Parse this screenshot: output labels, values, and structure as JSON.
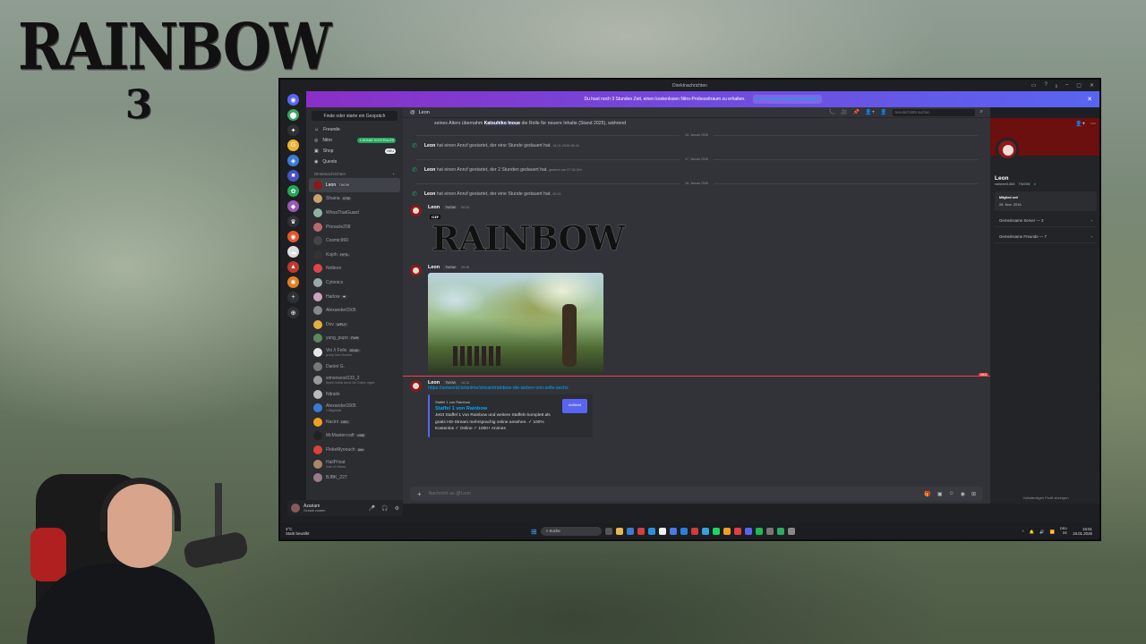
{
  "overlay": {
    "logo_text": "RAINBOW",
    "logo_number": "3"
  },
  "window": {
    "title": "Direktnachrichten",
    "controls": [
      "▭",
      "?",
      "⭳",
      "–",
      "▢",
      "✕"
    ]
  },
  "nitro_banner": {
    "text": "Du hast noch 3 Stunden Zeit, einen kostenlosen Nitro-Probezeitraum zu erhalten.",
    "link": "Hol dir dein kostenloses Nitro!",
    "close": "✕"
  },
  "rail": {
    "servers": [
      {
        "color": "#5865f2",
        "glyph": "◉"
      },
      {
        "color": "#3ba55c",
        "glyph": "⬤"
      },
      {
        "color": "#2f3136",
        "glyph": "✦"
      },
      {
        "color": "#f0b232",
        "glyph": "G"
      },
      {
        "color": "#3a7bd5",
        "glyph": "◈"
      },
      {
        "color": "#4752c4",
        "glyph": "■"
      },
      {
        "color": "#23a55a",
        "glyph": "✿"
      },
      {
        "color": "#9b59b6",
        "glyph": "◆"
      },
      {
        "color": "#2f3136",
        "glyph": "♛"
      },
      {
        "color": "#e4572e",
        "glyph": "◉"
      },
      {
        "color": "#ddd",
        "glyph": "☁"
      },
      {
        "color": "#c0392b",
        "glyph": "▲"
      },
      {
        "color": "#e67e22",
        "glyph": "✺"
      },
      {
        "color": "#2f3136",
        "glyph": "+"
      },
      {
        "color": "#2f3136",
        "glyph": "⊕"
      }
    ]
  },
  "sidebar": {
    "find_placeholder": "Finde oder starte ein Gespräch",
    "nav": [
      {
        "label": "Freunde",
        "icon": "☺"
      },
      {
        "label": "Nitro",
        "icon": "◎",
        "badge": "1 MONAT KOSTENLOS"
      },
      {
        "label": "Shop",
        "icon": "▣",
        "badge": "NEU"
      },
      {
        "label": "Quests",
        "icon": "◉"
      }
    ],
    "dm_header": "Direktnachrichten",
    "dm_add": "+",
    "dms": [
      {
        "name": "Leon",
        "tag": "TWOW",
        "color": "#8b1a1a"
      },
      {
        "name": "Shaina",
        "tag": "0730",
        "color": "#c9a46b"
      },
      {
        "name": "WhoaThatGuard",
        "tag": "",
        "color": "#8fb3a0"
      },
      {
        "name": "Pinnacle208",
        "tag": "",
        "color": "#b86a6a"
      },
      {
        "name": "Cosmic960",
        "tag": "",
        "color": "#444"
      },
      {
        "name": "Kojoh",
        "tag": "HYTL",
        "color": "#333"
      },
      {
        "name": "Notleon",
        "tag": "",
        "color": "#e0444a"
      },
      {
        "name": "Cytonics",
        "tag": "",
        "color": "#9aa"
      },
      {
        "name": "Harlow",
        "tag": "❤",
        "color": "#d0a0c0"
      },
      {
        "name": "Alexander1505",
        "tag": "",
        "color": "#888"
      },
      {
        "name": "Dov",
        "tag": "WPLC",
        "color": "#e0b040"
      },
      {
        "name": "yung_pupo",
        "tag": "FWH",
        "color": "#5a8a5a"
      },
      {
        "name": "Vio // Felix",
        "tag": "DEAD",
        "color": "#e6e6e6",
        "sub": "ja luty Garn flueche"
      },
      {
        "name": "Daniel G.",
        "tag": "",
        "color": "#777"
      },
      {
        "name": "simonwool133_2",
        "tag": "",
        "color": "#999",
        "sub": "Spielt Gothic Anniv Mo Gothic mgmt"
      },
      {
        "name": "Nitrailo",
        "tag": "",
        "color": "#bbb"
      },
      {
        "name": "Alexander1605",
        "tag": "",
        "color": "#3a7bd5",
        "sub": "1 Mitglieder"
      },
      {
        "name": "Nacini",
        "tag": "DED",
        "color": "#f0a020"
      },
      {
        "name": "McMastercraft",
        "tag": "VIBE",
        "color": "#222"
      },
      {
        "name": "FlokeMyoouch",
        "tag": "Adz",
        "color": "#dd4040"
      },
      {
        "name": "HailPrivat",
        "tag": "",
        "color": "#aa8866",
        "sub": "Vote of Virtnes"
      },
      {
        "name": "BJBK_227",
        "tag": "",
        "color": "#9a7a8a"
      }
    ]
  },
  "userbar": {
    "name": "Azariam",
    "status": "Gerade zocken",
    "icons": [
      "🎤",
      "🎧",
      "⚙"
    ]
  },
  "channel": {
    "name": "Leon",
    "header_icons": [
      "📞",
      "🎥",
      "📌",
      "👤+",
      "👤"
    ],
    "search_placeholder": "teinebrch365 suchen",
    "search_icon": "⌕"
  },
  "messages": {
    "intro_text_1": "seines Alters übernahm",
    "intro_highlight": "Katsuhiko Inoue",
    "intro_text_2": "die Rolle für neuere Inhalte (Stand 2025), während",
    "events": [
      {
        "date": "15. Januar 2026",
        "who": "Leon",
        "text": "hat einen Anruf gestartet, der eine Stunde gedauert hat.",
        "time": "16.01.2026 08:43"
      },
      {
        "date": "17. Januar 2026",
        "who": "Leon",
        "text": "hat einen Anruf gestartet, der 2 Stunden gedauert hat.",
        "time": "gestern um 07:34 Uhr"
      },
      {
        "date": "18. Januar 2026",
        "who": "Leon",
        "text": "hat einen Anruf gestartet, der eine Stunde gedauert hat.",
        "time": "00:21"
      }
    ],
    "gif_msg": {
      "name": "Leon",
      "tag": "TWOW",
      "time": "09:20",
      "gif_label": "GIF",
      "gif_text": "RAINBOW"
    },
    "img_msg": {
      "name": "Leon",
      "tag": "TWOW",
      "time": "09:32"
    },
    "new_marker": "NEU",
    "link_msg": {
      "name": "Leon",
      "tag": "TWOW",
      "time": "16:12",
      "url": "https://aniworld.to/anime/stream/rainbow-die-sieben-von-zelle-sechs",
      "embed_provider": "Staffel 1 von Rainbow",
      "embed_title": "Staffel 1 von Rainbow",
      "embed_desc": "Jetzt Staffel 1 von Rainbow und weitere Staffeln komplett als gratis HD-Stream mehrsprachig online ansehen. ✓ 100% Kostenlos ✓ Online ✓ 1000+ Animes",
      "embed_thumb": "AniWorld"
    }
  },
  "composer": {
    "plus": "+",
    "placeholder": "Nachricht an @Leon",
    "tools": [
      "🎁",
      "▣",
      "☺",
      "◉",
      "⊞"
    ]
  },
  "profile": {
    "name": "Leon",
    "username": "raiberet1365",
    "tag": "TWOW",
    "member_since_label": "Mitglied seit",
    "member_since": "26. Nov. 2016",
    "mutual_servers": "Gemeinsame Server — 2",
    "mutual_friends": "Gemeinsame Freunde — 7",
    "footer": "Vollständiges Profil anzeigen",
    "top_icons": [
      "👤+",
      "⋯"
    ]
  },
  "taskbar": {
    "weather_temp": "4°C",
    "weather_desc": "Stark bewölkt",
    "search": "Suche",
    "tray": [
      "^",
      "🔔",
      "🔊",
      "📶"
    ],
    "lang": "DEU\nDE",
    "time": "16:51",
    "date": "18.01.2026"
  },
  "colors": {
    "accent": "#5865f2",
    "online": "#23a55a",
    "danger": "#f23f43",
    "link": "#00a8fc"
  }
}
